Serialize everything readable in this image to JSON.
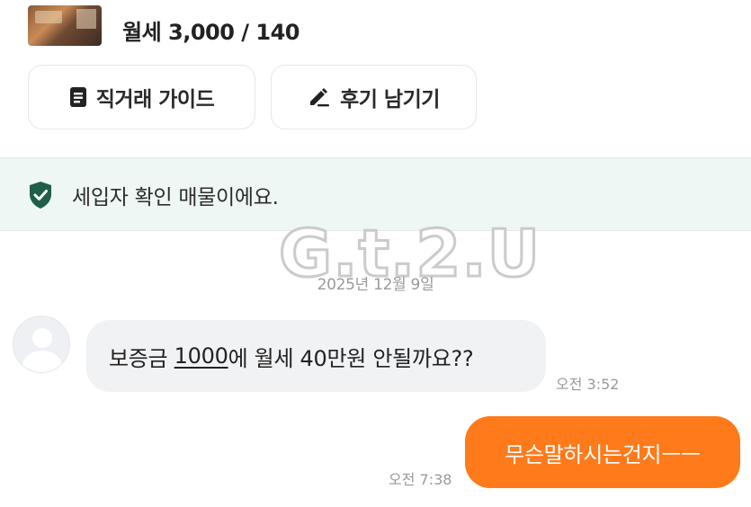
{
  "listing": {
    "price": "월세 3,000 / 140"
  },
  "actions": {
    "guide_label": "직거래 가이드",
    "review_label": "후기 남기기"
  },
  "banner": {
    "text": "세입자 확인 매물이에요."
  },
  "watermark": "G.t.2.U",
  "chat": {
    "date": "2025년 12월 9일",
    "incoming": {
      "text_before": "보증금 ",
      "text_underlined": "1000",
      "text_after": "에 월세 40만원 안될까요??",
      "time": "오전 3:52"
    },
    "outgoing": {
      "text": "무슨말하시는건지ㅡㅡ",
      "time": "오전 7:38"
    }
  },
  "colors": {
    "accent": "#ff7a1a",
    "banner_bg": "#eef7f3",
    "shield": "#1f5f4a",
    "incoming_bubble": "#f1f2f4"
  }
}
